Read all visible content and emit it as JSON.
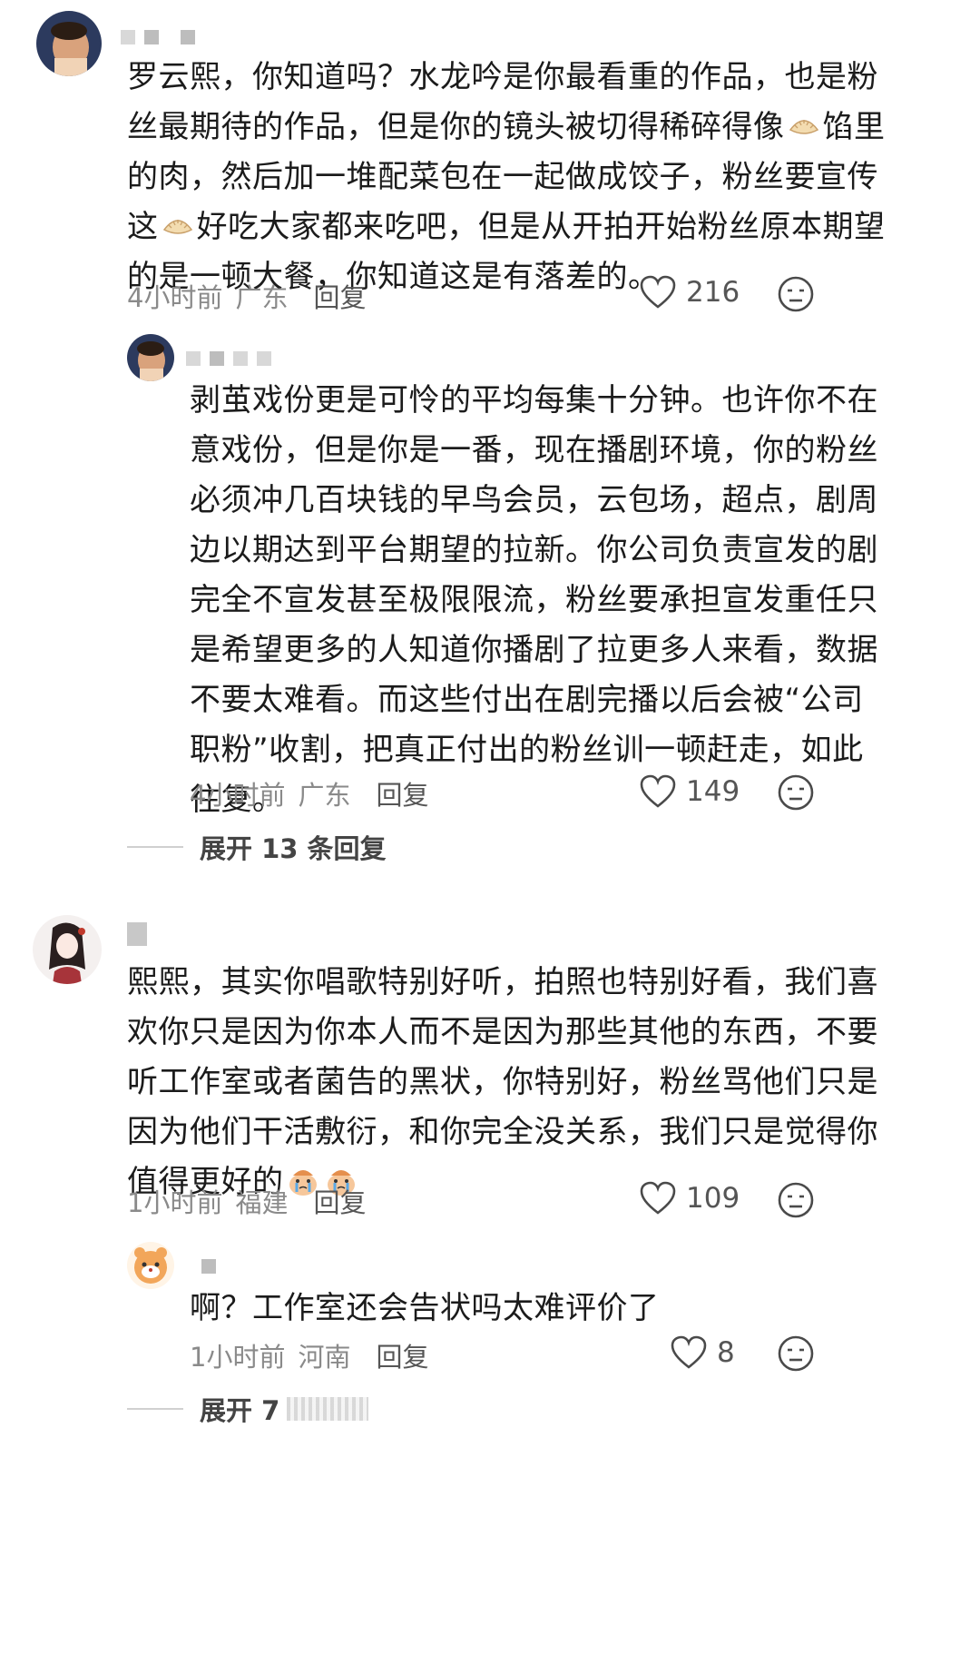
{
  "comments": [
    {
      "text_lines": [
        "罗云熙，你知道吗？水龙吟是你最看重的作品，也是粉",
        "丝最期待的作品，但是你的镜头被切得稀碎得像",
        "的肉，然后加一堆配菜包在一起做成饺子，粉丝要宣传",
        "这",
        "的是一顿大餐，你知道这是有落差的。"
      ],
      "line2_tail": "馅里",
      "line4_tail": "好吃大家都来吃吧，但是从开拍开始粉丝原本期望",
      "time": "4小时前",
      "location": "广东",
      "reply_label": "回复",
      "likes": "216"
    },
    {
      "text_lines": [
        "剥茧戏份更是可怜的平均每集十分钟。也许你不在",
        "意戏份，但是你是一番，现在播剧环境，你的粉丝",
        "必须冲几百块钱的早鸟会员，云包场，超点，剧周",
        "边以期达到平台期望的拉新。你公司负责宣发的剧",
        "完全不宣发甚至极限限流，粉丝要承担宣发重任只",
        "是希望更多的人知道你播剧了拉更多人来看，数据",
        "不要太难看。而这些付出在剧完播以后会被“公司",
        "职粉”收割，把真正付出的粉丝训一顿赶走，如此",
        "往复。"
      ],
      "time": "4小时前",
      "location": "广东",
      "reply_label": "回复",
      "likes": "149"
    },
    {
      "expand_label": "展开 13 条回复"
    },
    {
      "text_lines": [
        "熙熙，其实你唱歌特别好听，拍照也特别好看，我们喜",
        "欢你只是因为你本人而不是因为那些其他的东西，不要",
        "听工作室或者菌告的黑状，你特别好，粉丝骂他们只是",
        "因为他们干活敷衍，和你完全没关系，我们只是觉得你",
        "值得更好的"
      ],
      "time": "1小时前",
      "location": "福建",
      "reply_label": "回复",
      "likes": "109"
    },
    {
      "text_lines": [
        "啊？工作室还会告状吗太难评价了"
      ],
      "time": "1小时前",
      "location": "河南",
      "reply_label": "回复",
      "likes": "8"
    },
    {
      "expand_label": "展开 7"
    }
  ]
}
